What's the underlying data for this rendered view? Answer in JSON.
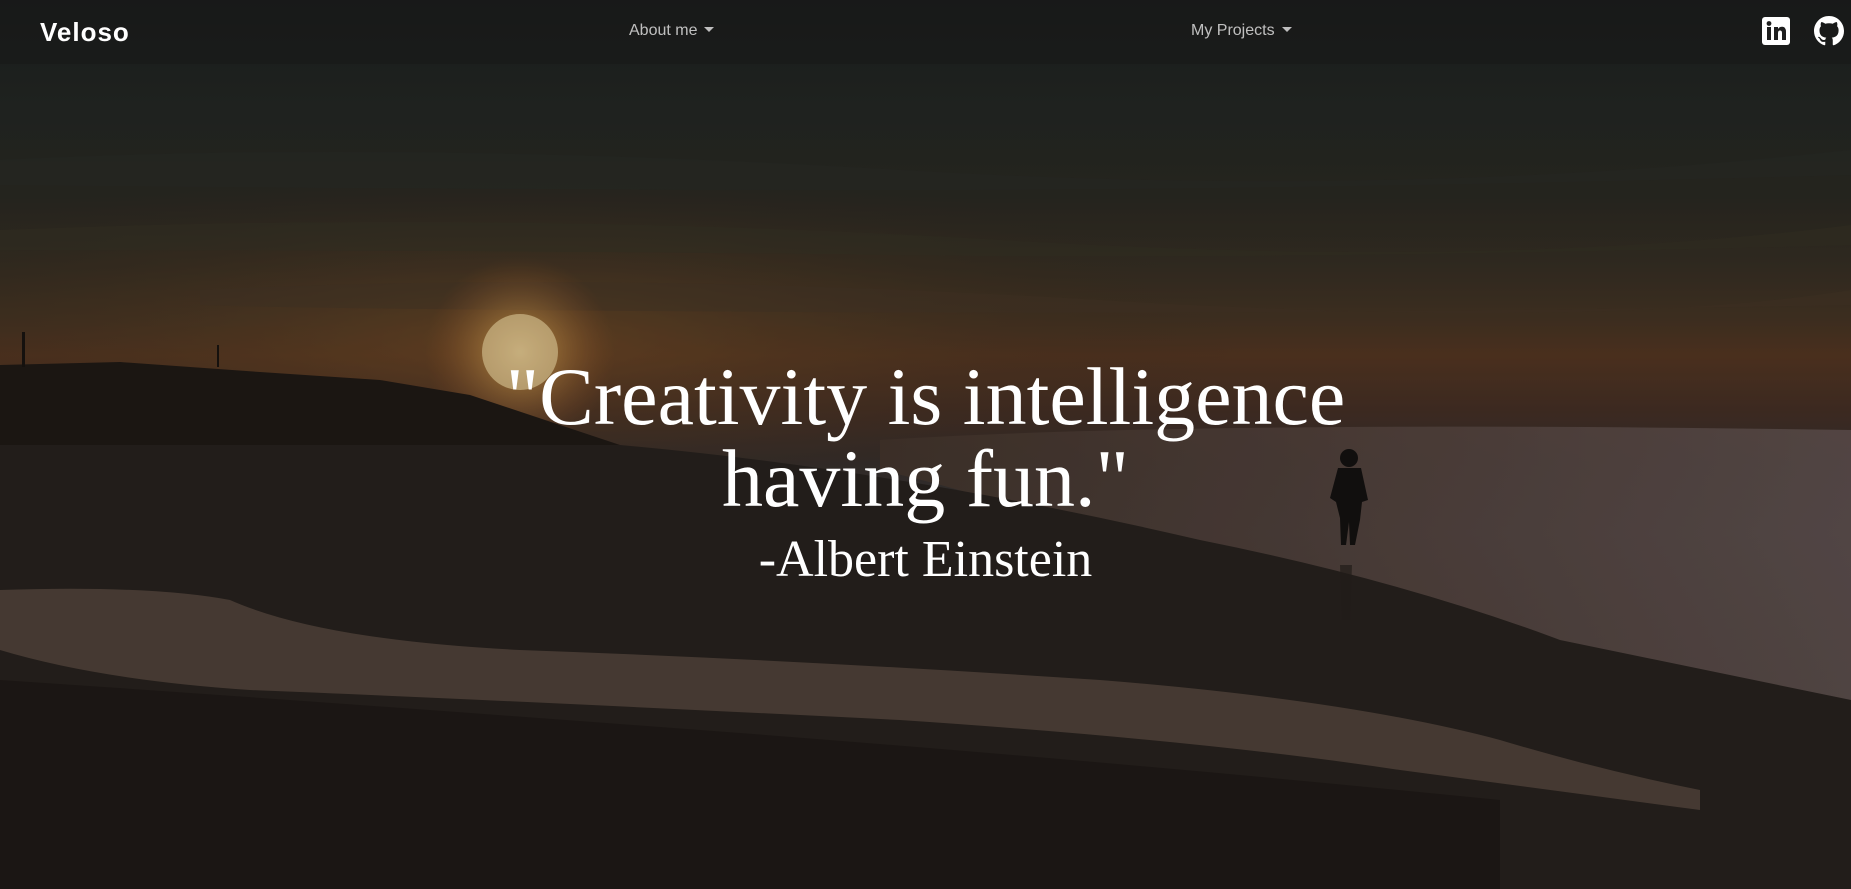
{
  "navbar": {
    "brand": "Veloso",
    "items": [
      {
        "label": "About me"
      },
      {
        "label": "My Projects"
      }
    ],
    "social": [
      {
        "icon": "linkedin-icon"
      },
      {
        "icon": "github-icon"
      }
    ]
  },
  "hero": {
    "quote": "\"Creativity is intelligence having fun.\"",
    "author": "-Albert Einstein"
  },
  "colors": {
    "text": "#ffffff",
    "nav_text": "#b8b8b8"
  }
}
